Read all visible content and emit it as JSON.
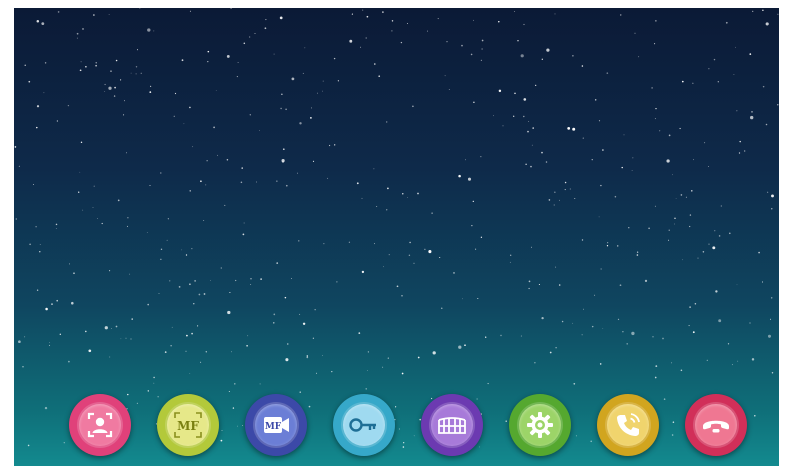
{
  "screen": {
    "background": "starry-night",
    "accent": "#0f6f79"
  },
  "dock": {
    "buttons": [
      {
        "icon": "face-recognition-icon",
        "label": "",
        "ring": "#e0417a",
        "fill": "#f07aa1"
      },
      {
        "icon": "monitor-photo-icon",
        "label": "MF",
        "ring": "#b3c93a",
        "fill": "#e6e889"
      },
      {
        "icon": "monitor-video-icon",
        "label": "MF",
        "ring": "#3c49a8",
        "fill": "#6b7ed6"
      },
      {
        "icon": "key-icon",
        "label": "",
        "ring": "#36a8c9",
        "fill": "#9fdaf0"
      },
      {
        "icon": "gate-icon",
        "label": "",
        "ring": "#6c3ab1",
        "fill": "#a77ad9"
      },
      {
        "icon": "settings-gear-icon",
        "label": "",
        "ring": "#55a82f",
        "fill": "#9cd468"
      },
      {
        "icon": "call-log-icon",
        "label": "",
        "ring": "#d1a51f",
        "fill": "#f0d46d"
      },
      {
        "icon": "hang-up-icon",
        "label": "",
        "ring": "#d12f59",
        "fill": "#ef7792"
      }
    ]
  }
}
